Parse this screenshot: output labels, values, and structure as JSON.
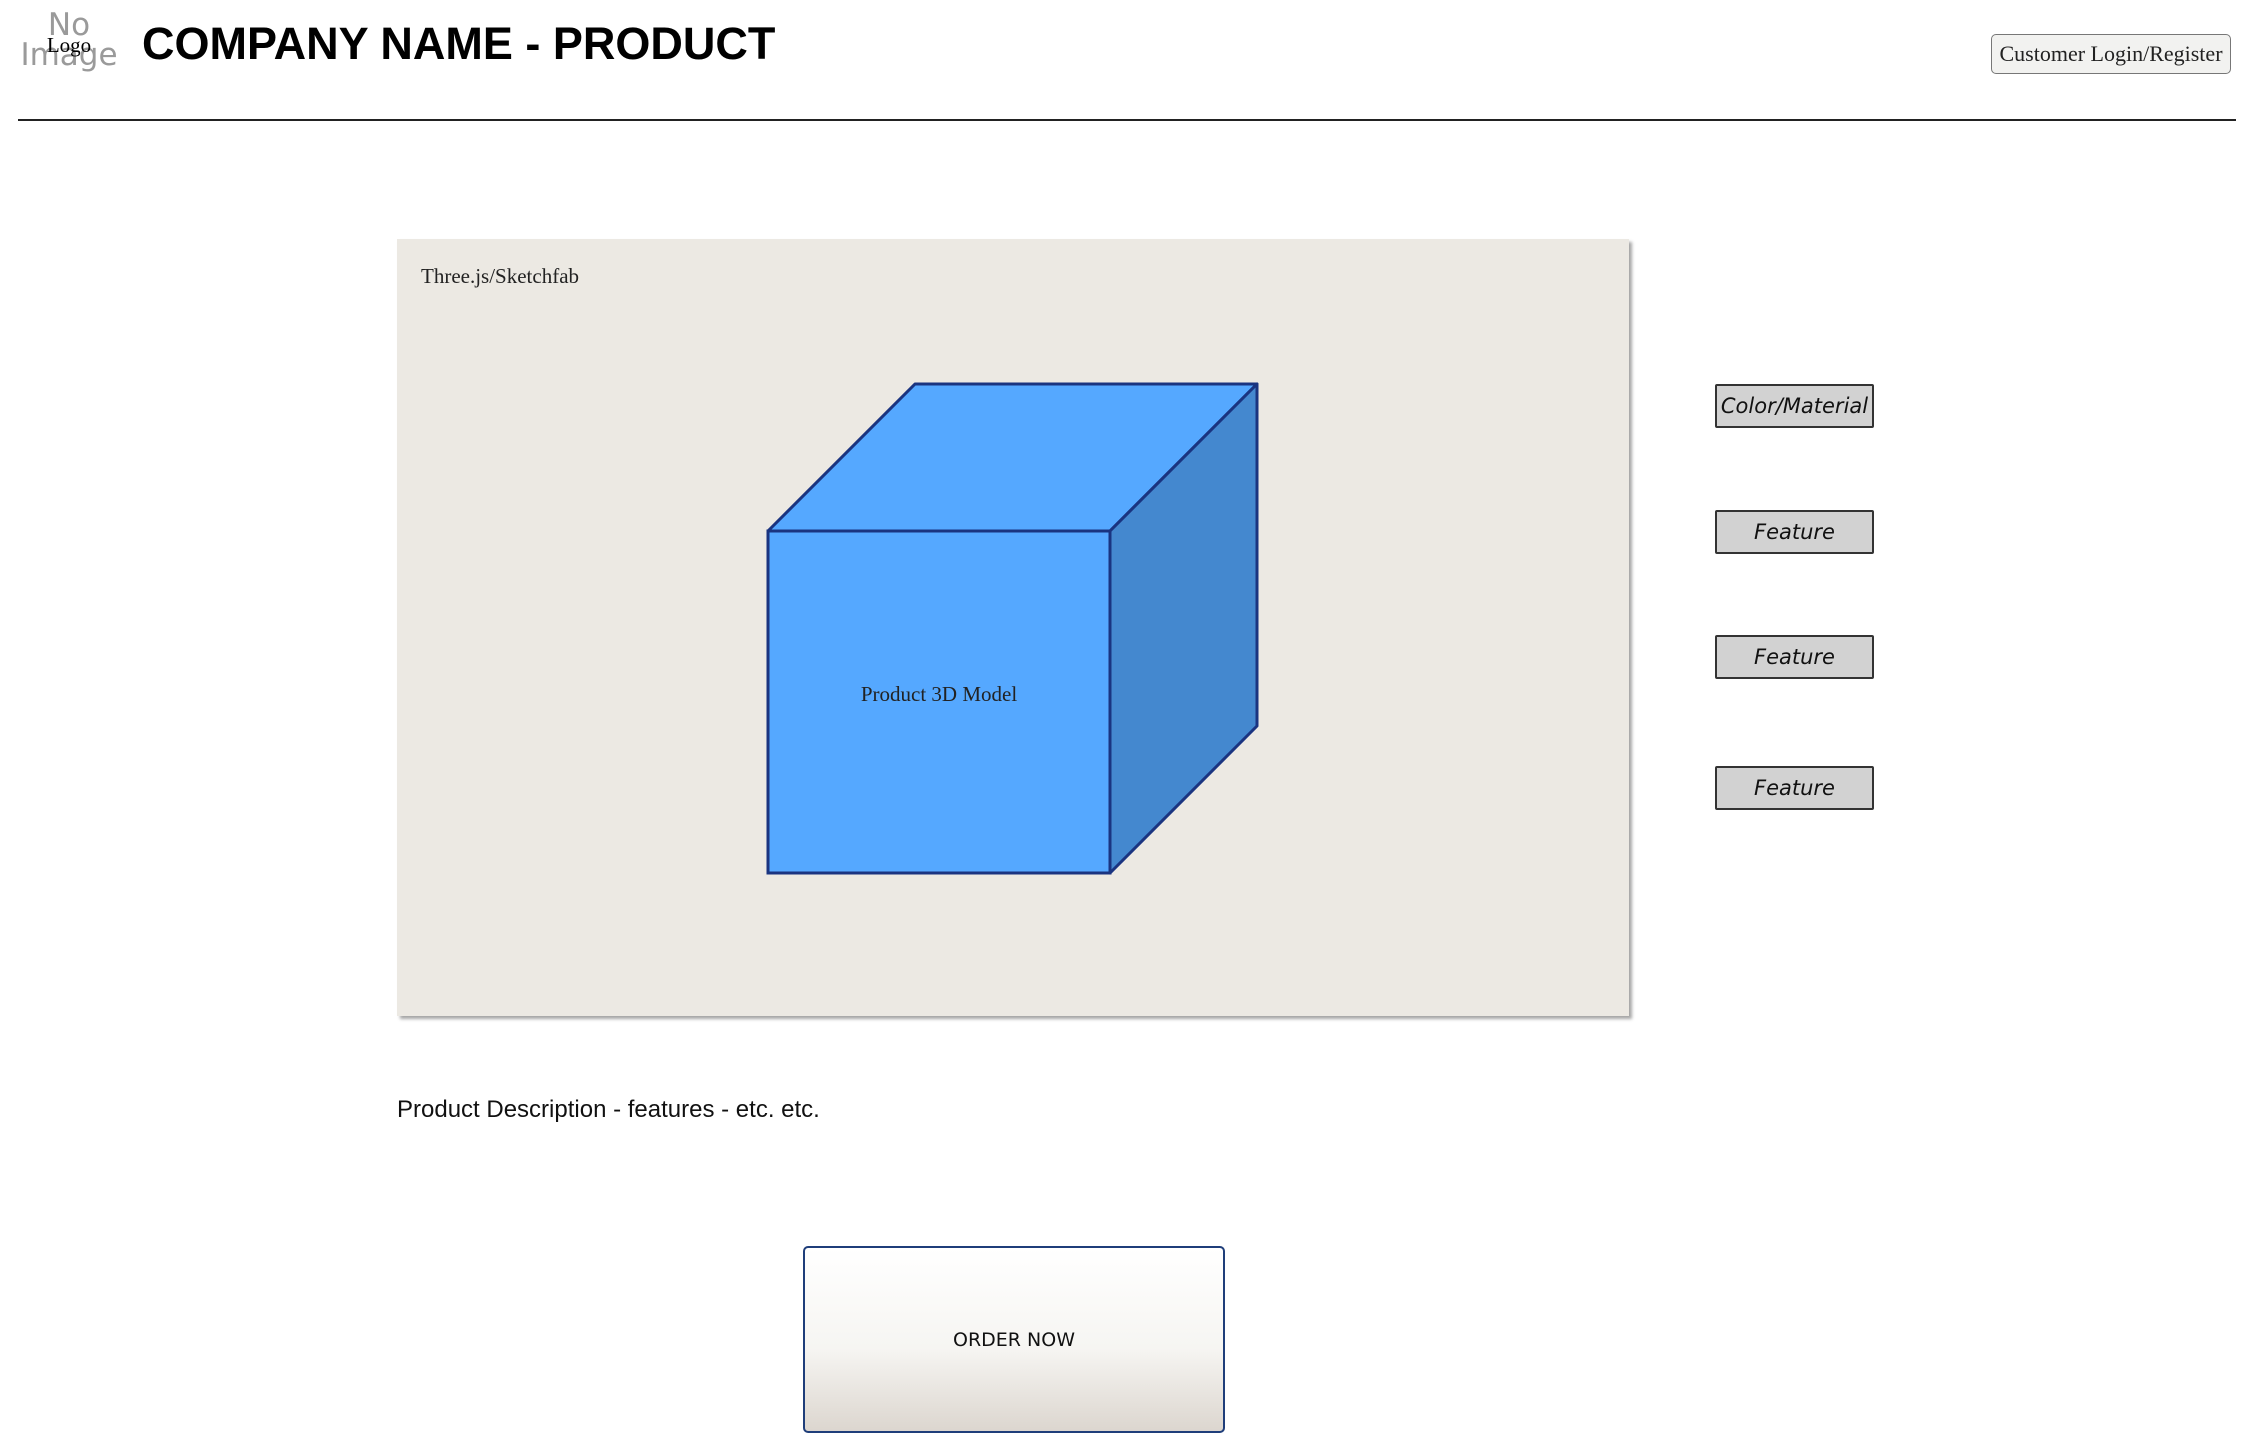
{
  "header": {
    "logo_placeholder": "No\nImage",
    "logo_label": "Logo",
    "title": "COMPANY NAME - PRODUCT",
    "login_label": "Customer Login/Register"
  },
  "viewer": {
    "label": "Three.js/Sketchfab",
    "model_label": "Product 3D Model",
    "colors": {
      "cube_front": "#55a8ff",
      "cube_top": "#55a8ff",
      "cube_side": "#4488cf",
      "cube_stroke": "#1a3480",
      "background": "#ece9e3"
    }
  },
  "options": {
    "items": [
      {
        "label": "Color/Material"
      },
      {
        "label": "Feature"
      },
      {
        "label": "Feature"
      },
      {
        "label": "Feature"
      }
    ]
  },
  "main": {
    "description": "Product Description - features - etc. etc.",
    "order_label": "ORDER NOW"
  }
}
